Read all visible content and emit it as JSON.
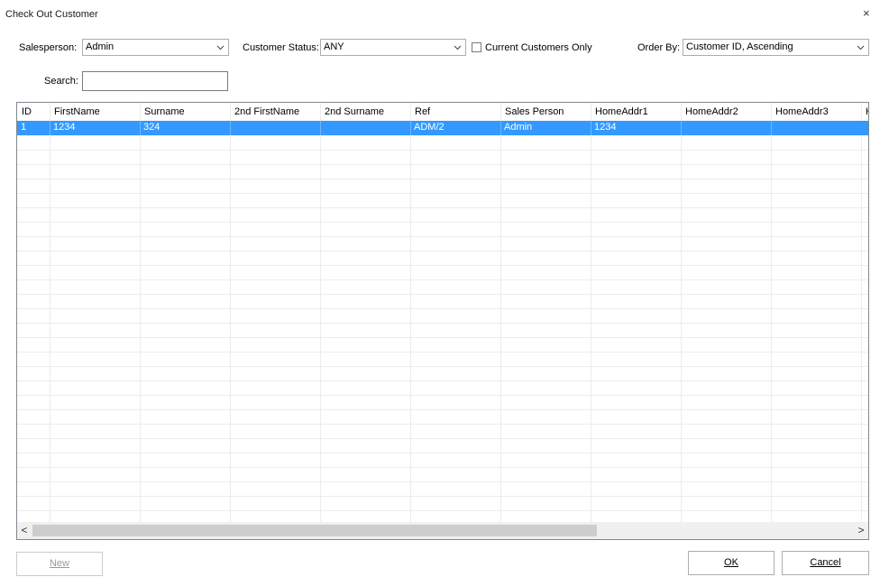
{
  "window": {
    "title": "Check Out Customer",
    "close_glyph": "×"
  },
  "filters": {
    "salesperson_label": "Salesperson:",
    "salesperson_value": "Admin",
    "customer_status_label": "Customer Status:",
    "customer_status_value": "ANY",
    "current_only_label": "Current Customers Only",
    "current_only_checked": false,
    "order_by_label": "Order By:",
    "order_by_value": "Customer ID, Ascending",
    "search_label": "Search:",
    "search_value": ""
  },
  "grid": {
    "columns": [
      "ID",
      "FirstName",
      "Surname",
      "2nd FirstName",
      "2nd Surname",
      "Ref",
      "Sales Person",
      "HomeAddr1",
      "HomeAddr2",
      "HomeAddr3",
      "H"
    ],
    "rows": [
      {
        "id": "1",
        "first_name": "1234",
        "surname": "324",
        "second_first_name": "",
        "second_surname": "",
        "ref": "ADM/2",
        "sales_person": "Admin",
        "home_addr1": "1234",
        "home_addr2": "",
        "home_addr3": ""
      }
    ],
    "selected_row": 0,
    "selection_color": "#3399ff"
  },
  "scrollbar": {
    "left_arrow": "<",
    "right_arrow": ">"
  },
  "buttons": {
    "new_label": "New",
    "ok_label": "OK",
    "cancel_label": "Cancel"
  }
}
